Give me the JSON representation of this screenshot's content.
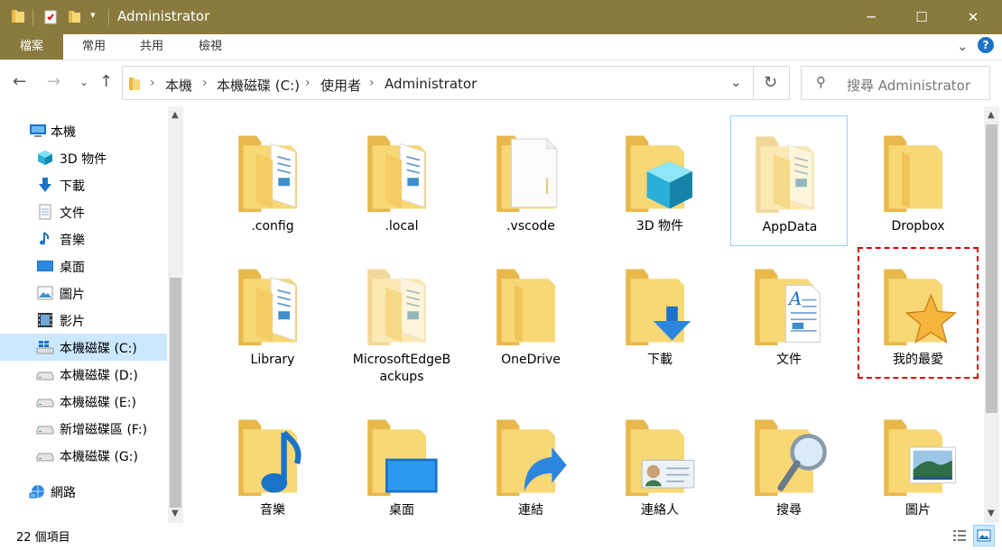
{
  "window": {
    "title": "Administrator",
    "controls": {
      "minimize": "─",
      "maximize": "☐",
      "close": "✕"
    },
    "titlebar_color": "#8a7a3d"
  },
  "ribbon": {
    "tabs": [
      "檔案",
      "常用",
      "共用",
      "檢視"
    ],
    "collapse_icon": "⌄",
    "help_icon": "?"
  },
  "address": {
    "crumbs": [
      "本機",
      "本機磁碟 (C:)",
      "使用者",
      "Administrator"
    ]
  },
  "search": {
    "placeholder": "搜尋 Administrator"
  },
  "sidebar": {
    "items": [
      {
        "label": "本機",
        "icon": "computer-icon"
      },
      {
        "label": "3D 物件",
        "icon": "3d-objects-icon"
      },
      {
        "label": "下載",
        "icon": "download-icon"
      },
      {
        "label": "文件",
        "icon": "documents-icon"
      },
      {
        "label": "音樂",
        "icon": "music-icon"
      },
      {
        "label": "桌面",
        "icon": "desktop-icon"
      },
      {
        "label": "圖片",
        "icon": "pictures-icon"
      },
      {
        "label": "影片",
        "icon": "videos-icon"
      },
      {
        "label": "本機磁碟 (C:)",
        "icon": "windows-drive-icon",
        "selected": true
      },
      {
        "label": "本機磁碟 (D:)",
        "icon": "drive-icon"
      },
      {
        "label": "本機磁碟 (E:)",
        "icon": "drive-icon"
      },
      {
        "label": "新增磁碟區 (F:)",
        "icon": "drive-icon"
      },
      {
        "label": "本機磁碟 (G:)",
        "icon": "drive-icon"
      },
      {
        "label": "網路",
        "icon": "network-icon"
      }
    ]
  },
  "folders": [
    {
      "name": ".config",
      "icon": "folder-docs"
    },
    {
      "name": ".local",
      "icon": "folder-docs"
    },
    {
      "name": ".vscode",
      "icon": "folder-blank-page"
    },
    {
      "name": "3D 物件",
      "icon": "folder-3d-cube"
    },
    {
      "name": "AppData",
      "icon": "folder-docs-faded",
      "hover": true
    },
    {
      "name": "Dropbox",
      "icon": "folder-plain"
    },
    {
      "name": "Library",
      "icon": "folder-docs"
    },
    {
      "name": "MicrosoftEdgeBackups",
      "icon": "folder-docs-faded"
    },
    {
      "name": "OneDrive",
      "icon": "folder-plain"
    },
    {
      "name": "下載",
      "icon": "folder-download"
    },
    {
      "name": "文件",
      "icon": "folder-document"
    },
    {
      "name": "我的最愛",
      "icon": "folder-star",
      "marked": true
    },
    {
      "name": "音樂",
      "icon": "folder-music"
    },
    {
      "name": "桌面",
      "icon": "folder-desktop"
    },
    {
      "name": "連結",
      "icon": "folder-link"
    },
    {
      "name": "連絡人",
      "icon": "folder-contact"
    },
    {
      "name": "搜尋",
      "icon": "folder-search"
    },
    {
      "name": "圖片",
      "icon": "folder-picture"
    }
  ],
  "status": {
    "count": "22 個項目"
  },
  "colors": {
    "folder": "#f8d775",
    "folder_back": "#e8b84a",
    "selection": "#cce8ff",
    "marker": "#e00000"
  }
}
